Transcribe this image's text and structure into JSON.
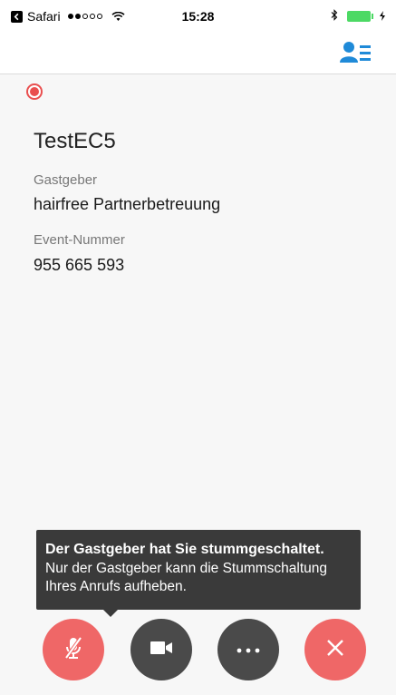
{
  "status_bar": {
    "carrier": "Safari",
    "time": "15:28"
  },
  "meeting": {
    "title": "TestEC5",
    "host_label": "Gastgeber",
    "host_value": "hairfree Partnerbetreuung",
    "event_label": "Event-Nummer",
    "event_value": "955 665 593"
  },
  "toast": {
    "title": "Der Gastgeber hat Sie stummgeschaltet.",
    "body": "Nur der Gastgeber kann die Stummschaltung Ihres Anrufs aufheben."
  },
  "controls": {
    "mute_icon": "microphone-muted-icon",
    "video_icon": "video-camera-icon",
    "more_icon": "ellipsis-icon",
    "end_icon": "close-icon"
  },
  "colors": {
    "record_red": "#e94f4f",
    "brand_blue": "#1f8ad8",
    "action_red": "#ef6767",
    "dark_button": "#4a4a4a",
    "toast_bg": "#3a3a3a"
  }
}
